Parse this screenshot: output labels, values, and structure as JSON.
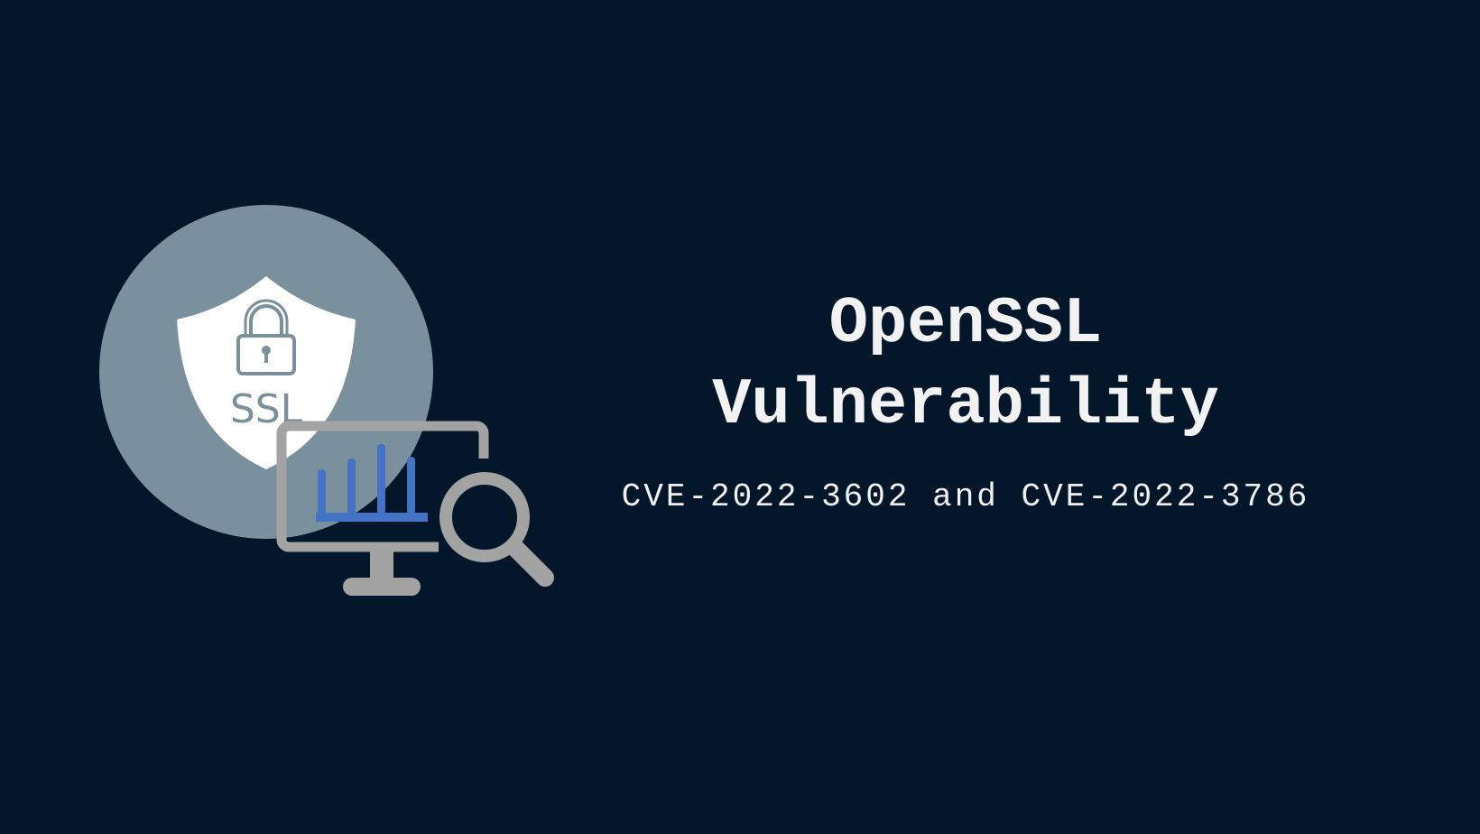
{
  "banner": {
    "title": "OpenSSL\nVulnerability",
    "subtitle": "CVE-2022-3602 and CVE-2022-3786"
  },
  "icon": {
    "shield_label": "SSL",
    "shield_icon": "shield-lock-icon",
    "monitor_icon": "monitor-chart-icon",
    "magnifier_icon": "magnifier-icon"
  },
  "colors": {
    "background": "#03162a",
    "circle": "#7a909c",
    "shield": "#ffffff",
    "monitor": "#a3a3a3",
    "chart": "#4472c4",
    "text": "#f2f2f2"
  }
}
